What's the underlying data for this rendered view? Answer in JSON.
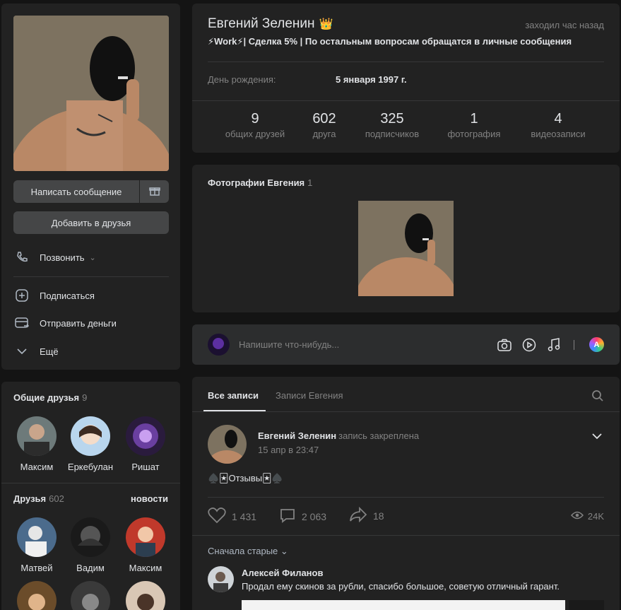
{
  "colors": {
    "background": "#141414",
    "card": "#222222",
    "text": "#e1e3e6",
    "muted": "#828282",
    "button": "#454647"
  },
  "left": {
    "buttons": {
      "message": "Написать сообщение",
      "add_friend": "Добавить в друзья"
    },
    "actions": {
      "call": "Позвонить",
      "subscribe": "Подписаться",
      "send_money": "Отправить деньги",
      "more": "Ещё"
    }
  },
  "mutual": {
    "title": "Общие друзья",
    "count": "9",
    "items": [
      {
        "name": "Максим"
      },
      {
        "name": "Еркебулан"
      },
      {
        "name": "Ришат"
      }
    ]
  },
  "friends": {
    "title": "Друзья",
    "count": "602",
    "news": "новости",
    "items": [
      {
        "name": "Матвей"
      },
      {
        "name": "Вадим"
      },
      {
        "name": "Максим"
      }
    ]
  },
  "profile": {
    "name": "Евгений Зеленин",
    "online": "заходил час назад",
    "status": "⚡Work⚡| Сделка 5% | По остальным вопросам обращатся в личные сообщения",
    "birthday_label": "День рождения:",
    "birthday_value": "5 января 1997 г.",
    "counters": [
      {
        "num": "9",
        "label": "общих друзей"
      },
      {
        "num": "602",
        "label": "друга"
      },
      {
        "num": "325",
        "label": "подписчиков"
      },
      {
        "num": "1",
        "label": "фотография"
      },
      {
        "num": "4",
        "label": "видеозаписи"
      }
    ]
  },
  "photos": {
    "title": "Фотографии Евгения",
    "count": "1"
  },
  "composer": {
    "placeholder": "Напишите что-нибудь..."
  },
  "wall": {
    "tabs": {
      "all": "Все записи",
      "own": "Записи Евгения"
    },
    "post": {
      "author": "Евгений Зеленин",
      "pinned": "запись закреплена",
      "date": "15 апр в 23:47",
      "text": "♠️🃏Отзывы🃏♠️",
      "likes": "1 431",
      "comments": "2 063",
      "shares": "18",
      "views": "24K"
    },
    "sort": "Сначала старые ⌄",
    "comment": {
      "author": "Алексей Филанов",
      "text": "Продал ему скинов за рубли, спасибо большое, советую отличный гарант."
    }
  }
}
